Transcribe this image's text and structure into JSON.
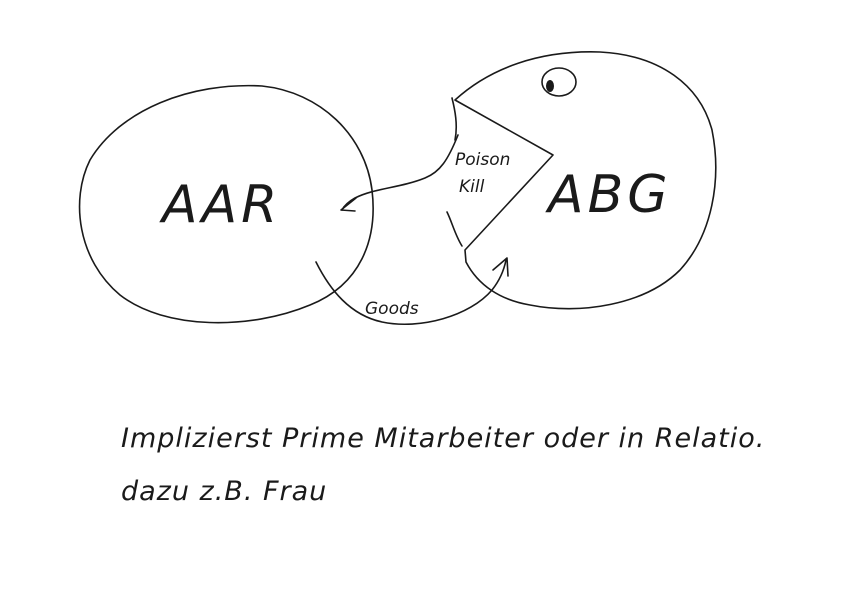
{
  "diagram": {
    "left_entity": "AAR",
    "right_entity": "ABG",
    "mouth_label_line1": "Poison",
    "mouth_label_line2": "Kill",
    "lower_arrow_label": "Goods"
  },
  "note": {
    "line1": "Implizierst Prime Mitarbeiter oder in Relatio.",
    "line2": "dazu z.B. Frau"
  },
  "colors": {
    "ink": "#1a1a1a",
    "background": "#ffffff"
  }
}
